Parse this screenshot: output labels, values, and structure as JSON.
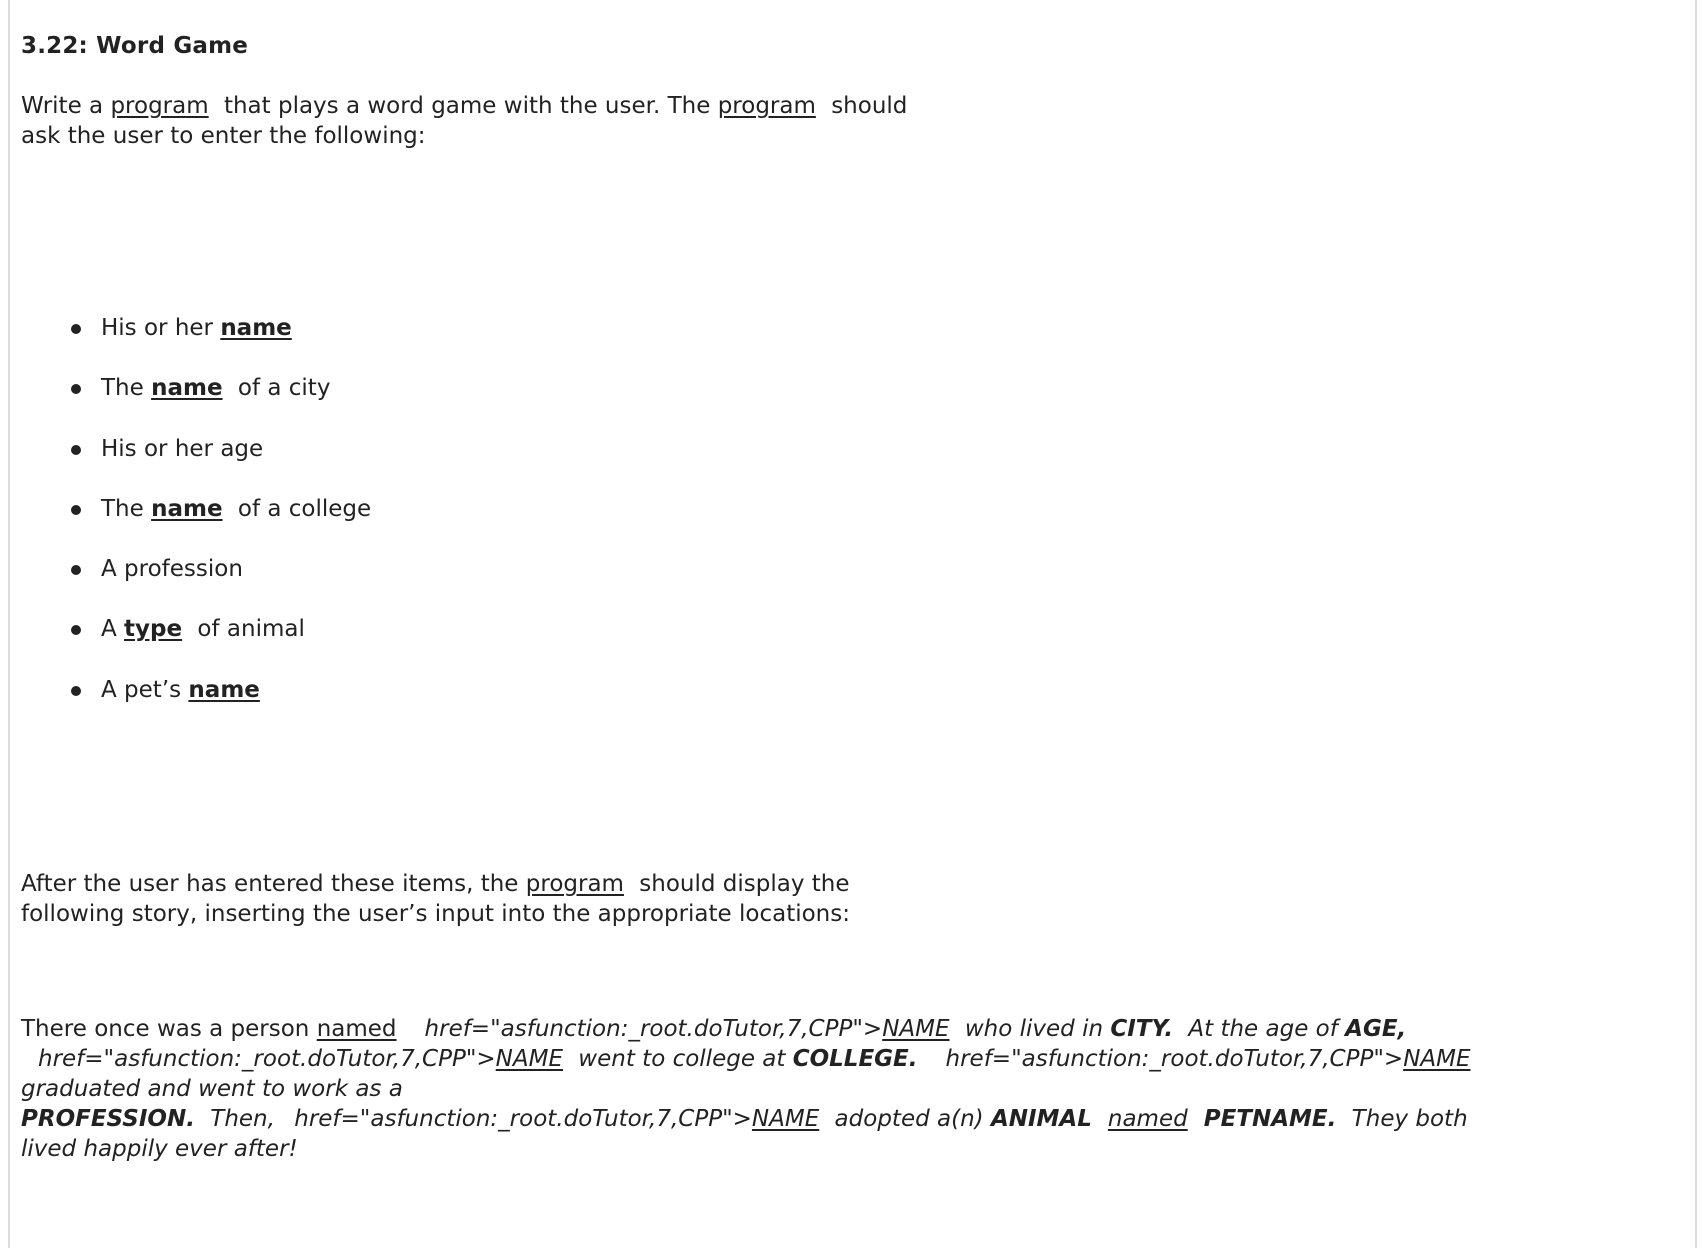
{
  "section": {
    "title": "3.22: Word Game"
  },
  "intro": {
    "line1_before": "Write a ",
    "link1": "program",
    "line1_mid": " that plays a word game with the user. The ",
    "link2": "program",
    "line1_after": " should",
    "line2": "ask the user to enter the following:"
  },
  "bullets": [
    {
      "before": "His or her ",
      "term": "name",
      "after": ""
    },
    {
      "before": "The ",
      "term": "name",
      "after": " of a city"
    },
    {
      "before": "His or her age",
      "term": "",
      "after": ""
    },
    {
      "before": "The ",
      "term": "name",
      "after": " of a college"
    },
    {
      "before": "A profession",
      "term": "",
      "after": ""
    },
    {
      "before": "A ",
      "term": "type",
      "after": " of animal"
    },
    {
      "before": "A pet’s ",
      "term": "name",
      "after": ""
    }
  ],
  "after": {
    "line1_before": "After the user has entered these items, the ",
    "link": "program",
    "line1_after": " should display the",
    "line2": "following story, inserting the user’s input into the appropriate locations:"
  },
  "story": {
    "l1_a": "There once was a person ",
    "l1_named": "named",
    "l1_href": "href=\"asfunction:_root.doTutor,7,CPP\">",
    "l1_name": "NAME",
    "l1_b": " who lived in ",
    "l1_city": "CITY.",
    "l1_c": " At the age of ",
    "l1_age": "AGE,",
    "l2_href1": "href=\"asfunction:_root.doTutor,7,CPP\">",
    "l2_name1": "NAME",
    "l2_a": " went to college at ",
    "l2_college": "COLLEGE.",
    "l2_href2": "href=\"asfunction:_root.doTutor,7,CPP\">",
    "l2_name2": "NAME",
    "l3": "graduated and went to work as a",
    "l4_profession": "PROFESSION.",
    "l4_a": " Then, ",
    "l4_href": "href=\"asfunction:_root.doTutor,7,CPP\">",
    "l4_name": "NAME",
    "l4_b": " adopted a(n) ",
    "l4_animal": "ANIMAL",
    "l4_named": "named",
    "l4_petname": "PETNAME.",
    "l4_c": " They both",
    "l5": "lived happily ever after!"
  }
}
